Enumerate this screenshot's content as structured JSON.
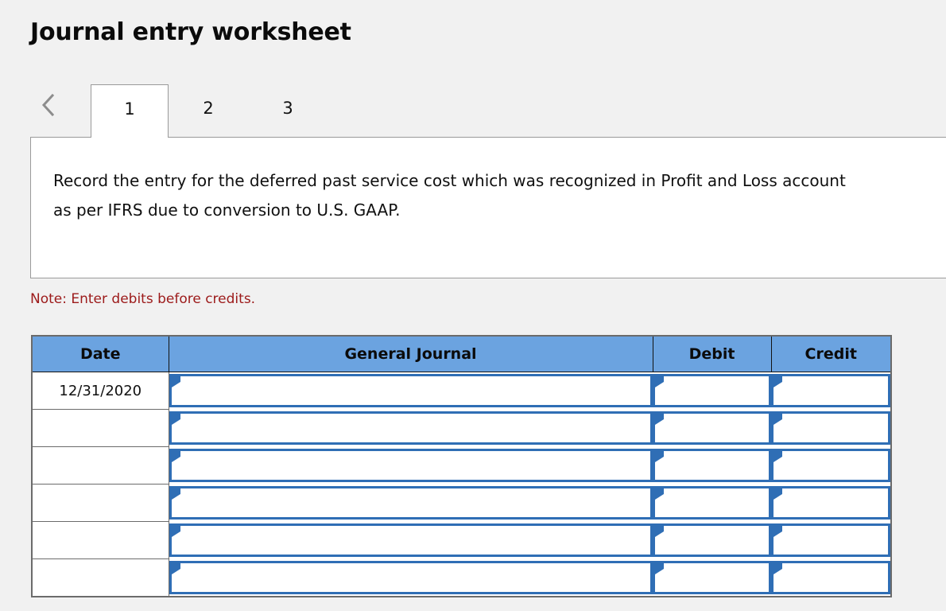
{
  "page": {
    "title": "Journal entry worksheet",
    "background_color": "#f1f1f1"
  },
  "tabs": {
    "prev_icon": "chevron-left-icon",
    "items": [
      {
        "label": "1",
        "active": true
      },
      {
        "label": "2",
        "active": false
      },
      {
        "label": "3",
        "active": false
      }
    ]
  },
  "panel": {
    "instruction": "Record the entry for the deferred past service cost which was recognized in Profit and Loss account as per IFRS due to conversion to U.S. GAAP."
  },
  "note": {
    "text": "Note: Enter debits before credits.",
    "color": "#9c1a1a"
  },
  "table": {
    "header_color": "#6ba3e0",
    "input_border_color": "#2f6eb5",
    "columns": [
      {
        "key": "date",
        "label": "Date"
      },
      {
        "key": "general_journal",
        "label": "General Journal"
      },
      {
        "key": "debit",
        "label": "Debit"
      },
      {
        "key": "credit",
        "label": "Credit"
      }
    ],
    "rows": [
      {
        "date": "12/31/2020",
        "general_journal": "",
        "debit": "",
        "credit": ""
      },
      {
        "date": "",
        "general_journal": "",
        "debit": "",
        "credit": ""
      },
      {
        "date": "",
        "general_journal": "",
        "debit": "",
        "credit": ""
      },
      {
        "date": "",
        "general_journal": "",
        "debit": "",
        "credit": ""
      },
      {
        "date": "",
        "general_journal": "",
        "debit": "",
        "credit": ""
      },
      {
        "date": "",
        "general_journal": "",
        "debit": "",
        "credit": ""
      }
    ]
  }
}
